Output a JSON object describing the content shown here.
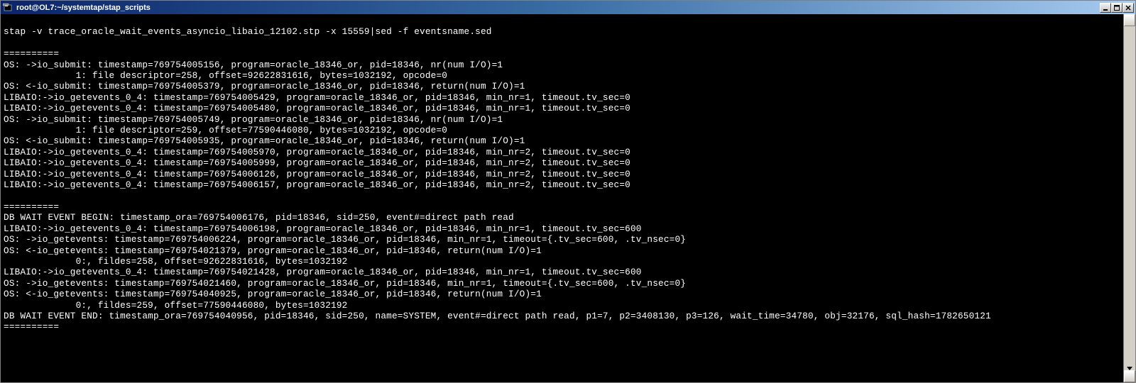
{
  "window": {
    "title": "root@OL7:~/systemtap/stap_scripts"
  },
  "terminal": {
    "lines": [
      "",
      "stap -v trace_oracle_wait_events_asyncio_libaio_12102.stp -x 15559|sed -f eventsname.sed",
      "",
      "==========",
      "OS: ->io_submit: timestamp=769754005156, program=oracle_18346_or, pid=18346, nr(num I/O)=1",
      "             1: file descriptor=258, offset=92622831616, bytes=1032192, opcode=0",
      "OS: <-io_submit: timestamp=769754005379, program=oracle_18346_or, pid=18346, return(num I/O)=1",
      "LIBAIO:->io_getevents_0_4: timestamp=769754005429, program=oracle_18346_or, pid=18346, min_nr=1, timeout.tv_sec=0",
      "LIBAIO:->io_getevents_0_4: timestamp=769754005480, program=oracle_18346_or, pid=18346, min_nr=1, timeout.tv_sec=0",
      "OS: ->io_submit: timestamp=769754005749, program=oracle_18346_or, pid=18346, nr(num I/O)=1",
      "             1: file descriptor=259, offset=77590446080, bytes=1032192, opcode=0",
      "OS: <-io_submit: timestamp=769754005935, program=oracle_18346_or, pid=18346, return(num I/O)=1",
      "LIBAIO:->io_getevents_0_4: timestamp=769754005970, program=oracle_18346_or, pid=18346, min_nr=2, timeout.tv_sec=0",
      "LIBAIO:->io_getevents_0_4: timestamp=769754005999, program=oracle_18346_or, pid=18346, min_nr=2, timeout.tv_sec=0",
      "LIBAIO:->io_getevents_0_4: timestamp=769754006126, program=oracle_18346_or, pid=18346, min_nr=2, timeout.tv_sec=0",
      "LIBAIO:->io_getevents_0_4: timestamp=769754006157, program=oracle_18346_or, pid=18346, min_nr=2, timeout.tv_sec=0",
      "",
      "==========",
      "DB WAIT EVENT BEGIN: timestamp_ora=769754006176, pid=18346, sid=250, event#=direct path read",
      "LIBAIO:->io_getevents_0_4: timestamp=769754006198, program=oracle_18346_or, pid=18346, min_nr=1, timeout.tv_sec=600",
      "OS: ->io_getevents: timestamp=769754006224, program=oracle_18346_or, pid=18346, min_nr=1, timeout={.tv_sec=600, .tv_nsec=0}",
      "OS: <-io_getevents: timestamp=769754021379, program=oracle_18346_or, pid=18346, return(num I/O)=1",
      "             0:, fildes=258, offset=92622831616, bytes=1032192",
      "LIBAIO:->io_getevents_0_4: timestamp=769754021428, program=oracle_18346_or, pid=18346, min_nr=1, timeout.tv_sec=600",
      "OS: ->io_getevents: timestamp=769754021460, program=oracle_18346_or, pid=18346, min_nr=1, timeout={.tv_sec=600, .tv_nsec=0}",
      "OS: <-io_getevents: timestamp=769754040925, program=oracle_18346_or, pid=18346, return(num I/O)=1",
      "             0:, fildes=259, offset=77590446080, bytes=1032192",
      "DB WAIT EVENT END: timestamp_ora=769754040956, pid=18346, sid=250, name=SYSTEM, event#=direct path read, p1=7, p2=3408130, p3=126, wait_time=34780, obj=32176, sql_hash=1782650121",
      "=========="
    ]
  }
}
